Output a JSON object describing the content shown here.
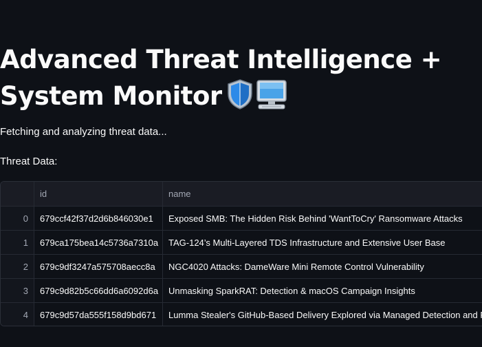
{
  "page": {
    "title_line1": "Advanced Threat Intelligence +",
    "title_line2": "System Monitor",
    "title_icons": [
      "shield-icon",
      "computer-icon"
    ],
    "status_text": "Fetching and analyzing threat data...",
    "table_label": "Threat Data:"
  },
  "table": {
    "columns": [
      "",
      "id",
      "name"
    ],
    "rows": [
      {
        "index": "0",
        "id": "679ccf42f37d2d6b846030e1",
        "name": "Exposed SMB: The Hidden Risk Behind 'WantToCry' Ransomware Attacks"
      },
      {
        "index": "1",
        "id": "679ca175bea14c5736a7310a",
        "name": "TAG-124’s Multi-Layered TDS Infrastructure and Extensive User Base"
      },
      {
        "index": "2",
        "id": "679c9df3247a575708aecc8a",
        "name": "NGC4020 Attacks: DameWare Mini Remote Control Vulnerability"
      },
      {
        "index": "3",
        "id": "679c9d82b5c66dd6a6092d6a",
        "name": "Unmasking SparkRAT: Detection & macOS Campaign Insights"
      },
      {
        "index": "4",
        "id": "679c9d57da555f158d9bd671",
        "name": "Lumma Stealer's GitHub-Based Delivery Explored via Managed Detection and Response"
      }
    ]
  },
  "colors": {
    "background": "#0e1117",
    "text": "#fafafa",
    "muted": "#a3a8b4",
    "border": "#2b2f38"
  }
}
